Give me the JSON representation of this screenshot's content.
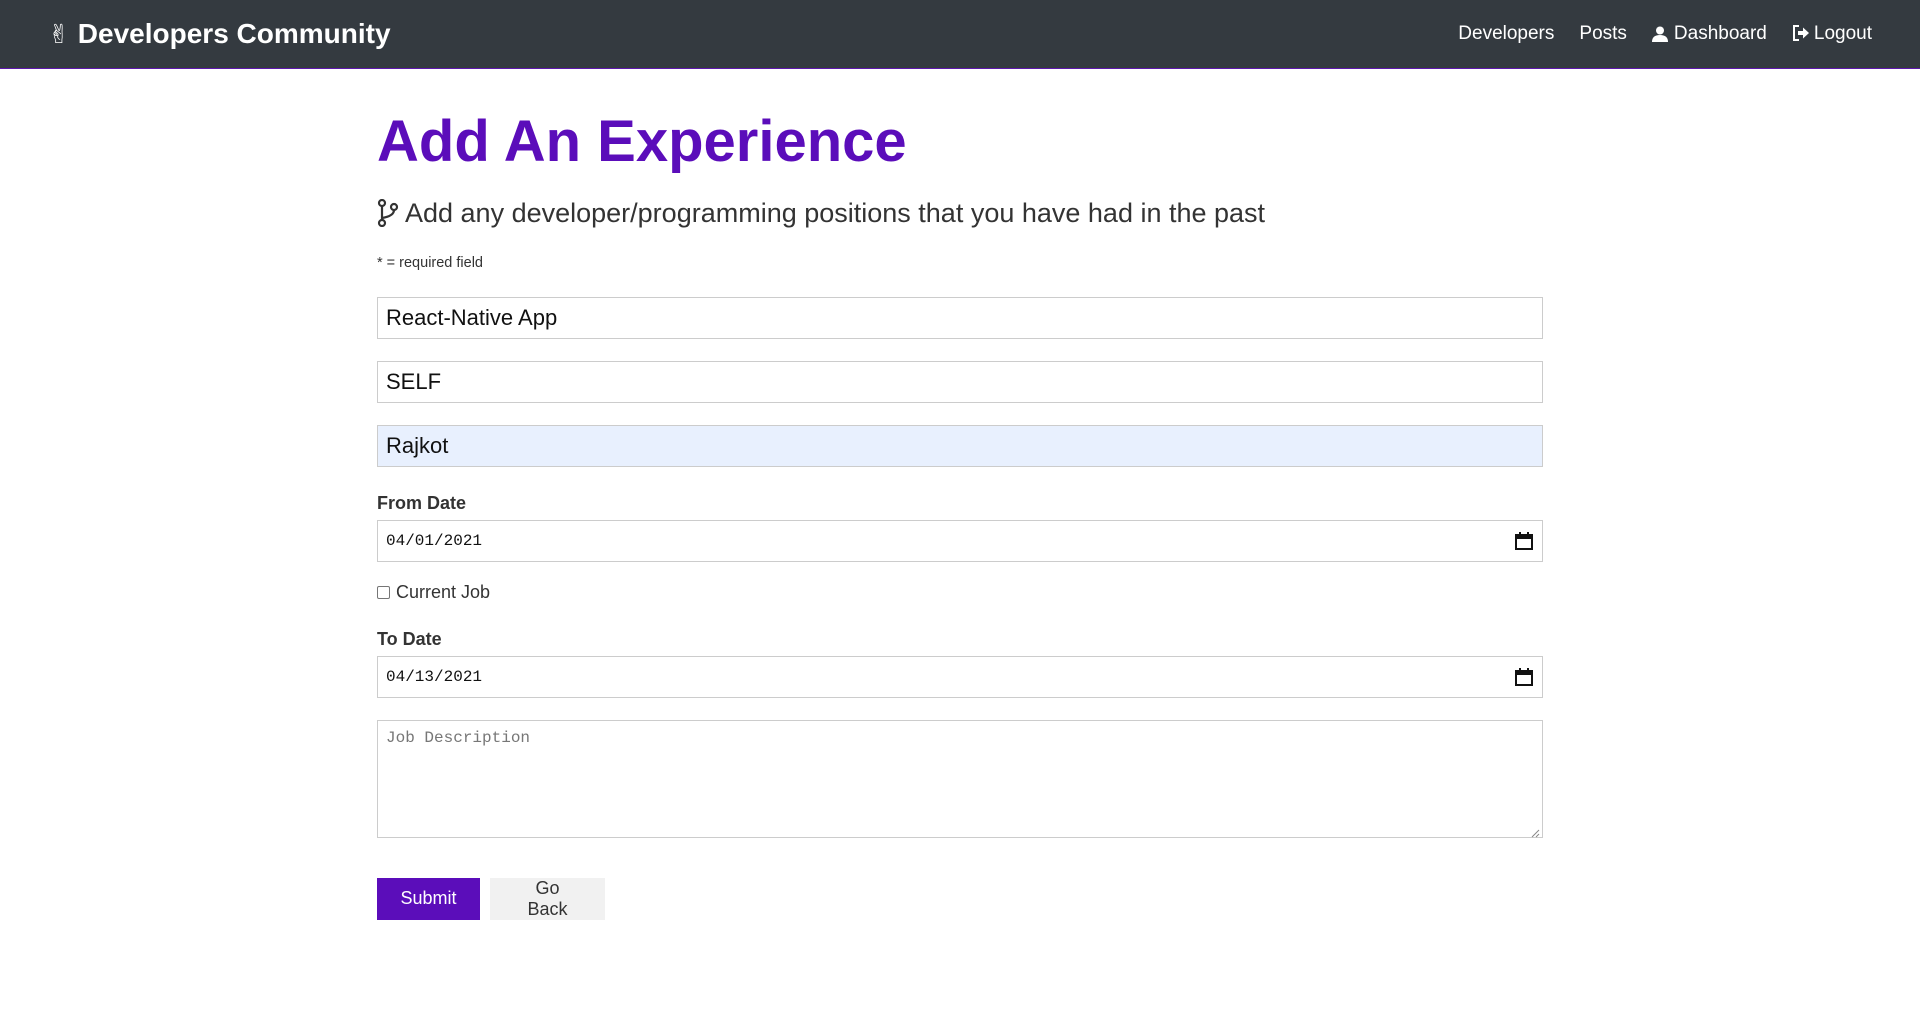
{
  "navbar": {
    "brand_icon": "peace-hand-icon",
    "brand_label": "Developers Community",
    "links": [
      {
        "label": "Developers"
      },
      {
        "label": "Posts"
      },
      {
        "label": "Dashboard",
        "icon": "user-icon"
      },
      {
        "label": "Logout",
        "icon": "sign-out-icon"
      }
    ]
  },
  "page": {
    "title": "Add An Experience",
    "lead_icon": "code-branch-icon",
    "lead": "Add any developer/programming positions that you have had in the past",
    "required_note": "* = required field"
  },
  "form": {
    "job_title_value": "React-Native App",
    "company_value": "SELF",
    "location_value": "Rajkot",
    "from_label": "From Date",
    "from_value": "04/01/2021",
    "current_label": "Current Job",
    "current_checked": false,
    "to_label": "To Date",
    "to_value": "04/13/2021",
    "description_placeholder": "Job Description",
    "submit_label": "Submit",
    "back_label": "Go Back"
  },
  "colors": {
    "navbar_bg": "#343a40",
    "primary": "#5b0dba",
    "autofill_bg": "#e8f0fe"
  }
}
